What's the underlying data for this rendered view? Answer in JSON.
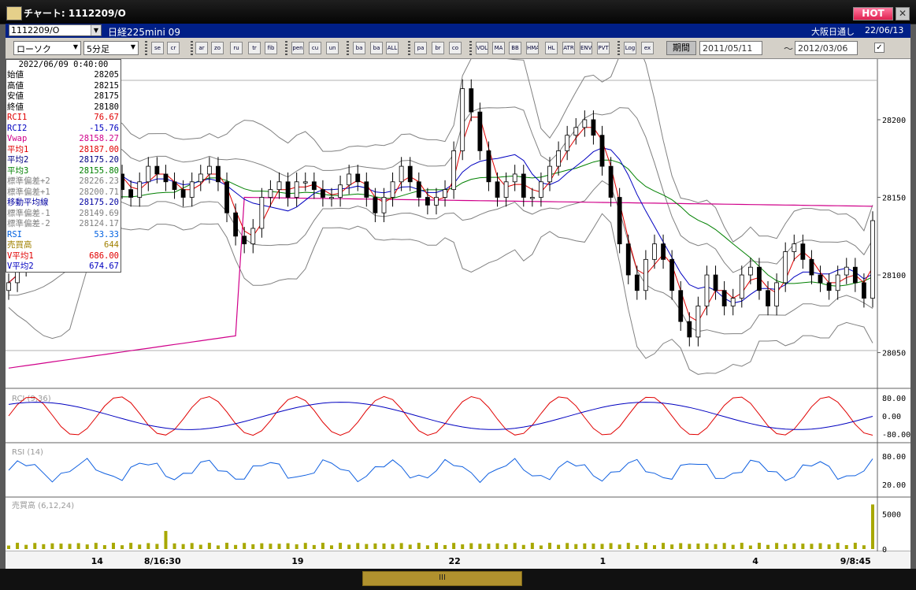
{
  "window": {
    "title": "チャート: 1112209/O",
    "hot_label": "HOT",
    "close_label": "✕"
  },
  "infobar": {
    "code": "1112209/O",
    "symbol_name": "日経225mini 09",
    "market": "大阪日通し",
    "date": "22/06/13"
  },
  "toolbar": {
    "chart_type": "ローソク",
    "interval": "5分足",
    "buttons": [
      "search",
      "crosshair",
      "arrow",
      "zoom",
      "ruler",
      "trend",
      "fib",
      "pen",
      "cursor",
      "undo",
      "bar1",
      "bar2",
      "ALL",
      "pattern",
      "brush",
      "color",
      "VOL",
      "MA",
      "BB",
      "HMA",
      "HL",
      "ATR",
      "ENV",
      "PVT",
      "Log",
      "export"
    ],
    "period_label": "期間",
    "date_from": "2011/05/11",
    "date_to": "2012/03/06",
    "tilde": "～",
    "check": "✓"
  },
  "info_panel": {
    "datetime": "2022/06/09 0:40:00",
    "rows": [
      {
        "label": "始値",
        "value": "28205",
        "color": "#000000"
      },
      {
        "label": "高値",
        "value": "28215",
        "color": "#000000"
      },
      {
        "label": "安値",
        "value": "28175",
        "color": "#000000"
      },
      {
        "label": "終値",
        "value": "28180",
        "color": "#000000"
      },
      {
        "label": "RCI1",
        "value": "76.67",
        "color": "#e00000"
      },
      {
        "label": "RCI2",
        "value": "-15.76",
        "color": "#0000c0"
      },
      {
        "label": "Vwap",
        "value": "28158.27",
        "color": "#d0008a"
      },
      {
        "label": "平均1",
        "value": "28187.00",
        "color": "#e00000"
      },
      {
        "label": "平均2",
        "value": "28175.20",
        "color": "#000080"
      },
      {
        "label": "平均3",
        "value": "28155.80",
        "color": "#008000"
      },
      {
        "label": "標準偏差+2",
        "value": "28226.23",
        "color": "#808080"
      },
      {
        "label": "標準偏差+1",
        "value": "28200.71",
        "color": "#808080"
      },
      {
        "label": "移動平均線",
        "value": "28175.20",
        "color": "#0000a0"
      },
      {
        "label": "標準偏差-1",
        "value": "28149.69",
        "color": "#808080"
      },
      {
        "label": "標準偏差-2",
        "value": "28124.17",
        "color": "#808080"
      },
      {
        "label": "RSI",
        "value": "53.33",
        "color": "#0060e0"
      },
      {
        "label": "売買高",
        "value": "644",
        "color": "#a08000"
      },
      {
        "label": "V平均1",
        "value": "686.00",
        "color": "#e00000"
      },
      {
        "label": "V平均2",
        "value": "674.67",
        "color": "#0000c0"
      }
    ]
  },
  "chart_data": [
    {
      "type": "candlestick",
      "y_ticks": [
        "28200",
        "28150",
        "28100",
        "28050"
      ],
      "ylim": [
        28030,
        28235
      ],
      "x_ticks": [
        "14",
        "8/16:30",
        "19",
        "22",
        "1",
        "4",
        "9/8:45"
      ],
      "overlays": [
        "Vwap",
        "平均1",
        "平均2",
        "平均3",
        "ボリンジャーバンド"
      ],
      "series": [
        {
          "name": "終値",
          "values": [
            28095,
            28105,
            28120,
            28140,
            28160,
            28175,
            28180,
            28170,
            28160,
            28150,
            28160,
            28170,
            28165,
            28155,
            28150,
            28160,
            28170,
            28165,
            28160,
            28155,
            28150,
            28160,
            28165,
            28170,
            28160,
            28140,
            28125,
            28120,
            28130,
            28150,
            28155,
            28160,
            28150,
            28160,
            28160,
            28155,
            28150,
            28150,
            28158,
            28165,
            28160,
            28150,
            28140,
            28150,
            28160,
            28170,
            28160,
            28150,
            28145,
            28150,
            28155,
            28180,
            28220,
            28205,
            28180,
            28160,
            28150,
            28160,
            28165,
            28150,
            28150,
            28160,
            28170,
            28180,
            28190,
            28195,
            28200,
            28190,
            28170,
            28150,
            28120,
            28100,
            28090,
            28110,
            28120,
            28110,
            28090,
            28070,
            28060,
            28080,
            28100,
            28090,
            28080,
            28085,
            28100,
            28105,
            28090,
            28080,
            28095,
            28115,
            28120,
            28110,
            28100,
            28095,
            28090,
            28100,
            28105,
            28095,
            28085,
            28135
          ]
        }
      ]
    },
    {
      "type": "line",
      "title": "RCI (9,36)",
      "y_ticks": [
        "80.00",
        "0.00",
        "-80.00"
      ],
      "ylim": [
        -100,
        100
      ]
    },
    {
      "type": "line",
      "title": "RSI (14)",
      "y_ticks": [
        "80.00",
        "20.00"
      ],
      "ylim": [
        0,
        100
      ]
    },
    {
      "type": "bar",
      "title": "売買高 (6,12,24)",
      "y_ticks": [
        "5000",
        "0"
      ],
      "ylim": [
        0,
        7000
      ]
    }
  ],
  "colors": {
    "bg": "#ffffff",
    "grid": "#b0b0b0",
    "vwap": "#d0008a",
    "ma1": "#e00000",
    "ma2": "#0000c0",
    "ma3": "#008000",
    "rsi": "#1060e0",
    "vol": "#a8a800"
  }
}
